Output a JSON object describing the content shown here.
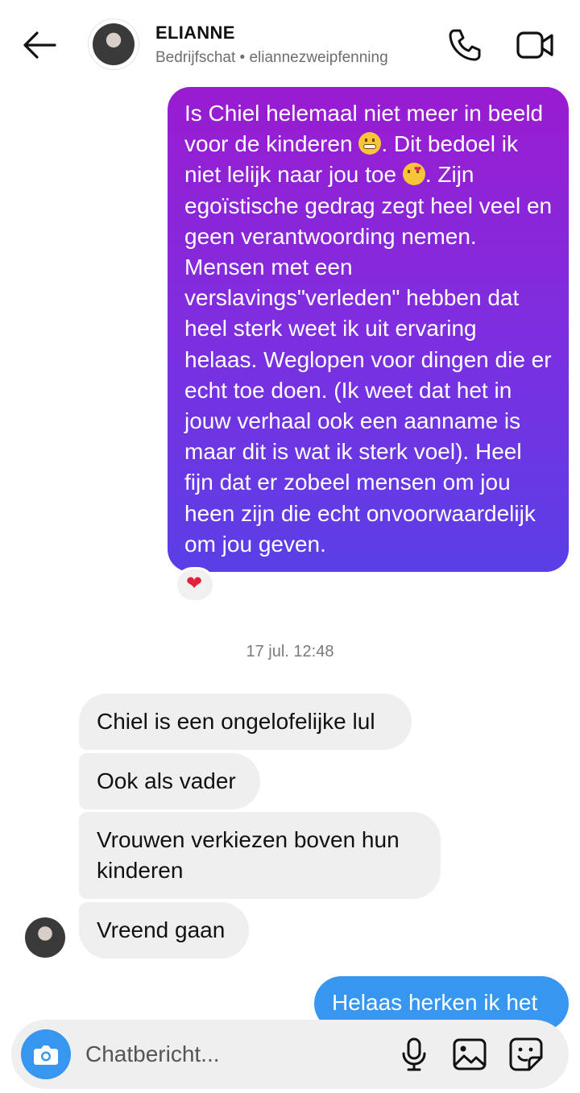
{
  "header": {
    "contact_name": "ELIANNE",
    "subtitle": "Bedrijfschat • eliannezweipfenning"
  },
  "messages": {
    "outgoing_1": {
      "seg1": "Is Chiel helemaal niet meer in beeld voor de kinderen ",
      "emoji1": "grimacing-face-emoji",
      "seg2": ". Dit bedoel ik niet lelijk naar jou toe ",
      "emoji2": "kissing-face-emoji",
      "seg3": ". Zijn egoïstische gedrag zegt heel veel en geen verantwoording nemen. Mensen met een verslavings\"verleden\" hebben dat heel sterk weet ik uit ervaring helaas. Weglopen voor dingen die er echt toe doen. (Ik weet dat het in jouw verhaal ook een aanname is maar dit is wat ik sterk voel). Heel fijn dat er zobeel mensen om jou heen zijn die echt onvoorwaardelijk om jou geven.",
      "reaction": "❤",
      "reaction_color": "#e3213a"
    },
    "timestamp": "17 jul. 12:48",
    "incoming": [
      {
        "text": "Chiel is een ongelofelijke lul"
      },
      {
        "text": "Ook als vader"
      },
      {
        "text": "Vrouwen verkiezen boven hun kinderen"
      },
      {
        "text": "Vreend gaan"
      }
    ],
    "outgoing_2": "Helaas herken ik het"
  },
  "composer": {
    "placeholder": "Chatbericht..."
  },
  "colors": {
    "outgoing_gradient_top": "#9a1bd0",
    "outgoing_gradient_bottom": "#5a3fe6",
    "accent_blue": "#3797f0",
    "incoming_bubble": "#efefef"
  }
}
